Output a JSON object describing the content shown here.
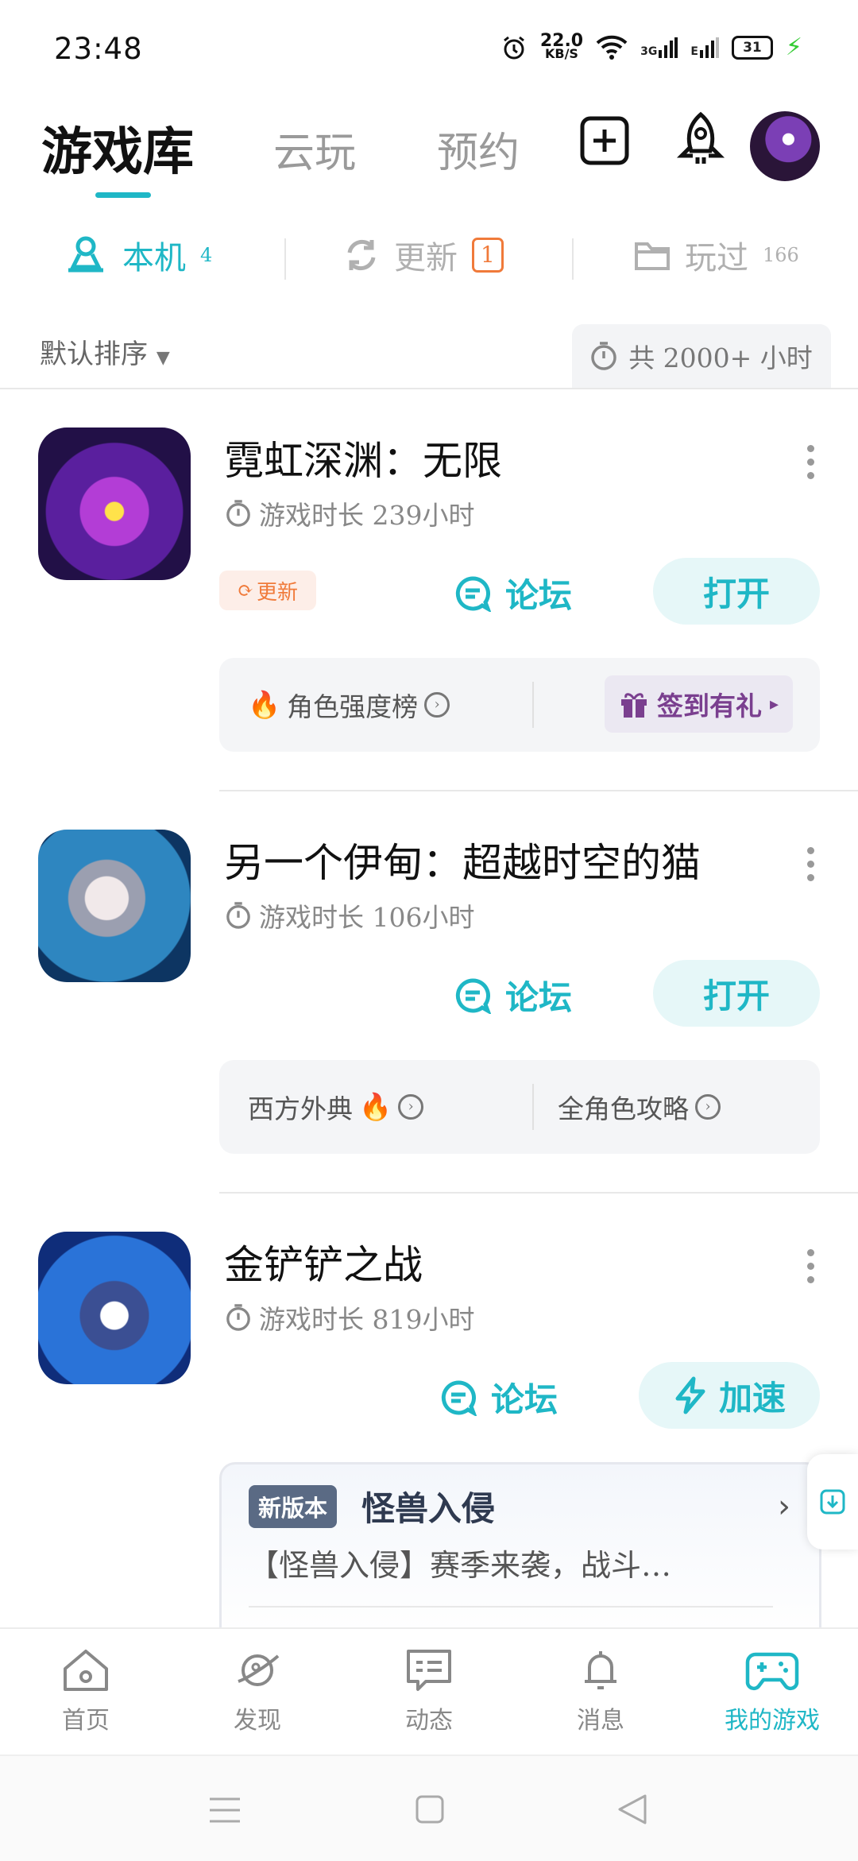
{
  "status_bar": {
    "time": "23:48",
    "net_speed_value": "22.0",
    "net_speed_unit": "KB/S",
    "network_3g": "3G",
    "network_e": "E",
    "battery": "31"
  },
  "header": {
    "tabs": [
      {
        "label": "游戏库",
        "active": true
      },
      {
        "label": "云玩",
        "active": false
      },
      {
        "label": "预约",
        "active": false
      }
    ],
    "icons": [
      "add-square-icon",
      "rocket-icon",
      "avatar"
    ]
  },
  "sub_tabs": [
    {
      "label": "本机",
      "count": "4",
      "icon": "local-device-icon",
      "active": true
    },
    {
      "label": "更新",
      "count": "1",
      "icon": "refresh-icon",
      "active": false
    },
    {
      "label": "玩过",
      "count": "166",
      "icon": "folder-icon",
      "active": false
    }
  ],
  "sort": {
    "label": "默认排序"
  },
  "total_hours": {
    "label": "共 2000+ 小时"
  },
  "games": [
    {
      "title": "霓虹深渊：无限",
      "time_label": "游戏时长 239小时",
      "update_label": "更新",
      "forum_label": "论坛",
      "action_label": "打开",
      "info_left": "角色强度榜",
      "info_right": "签到有礼"
    },
    {
      "title": "另一个伊甸：超越时空的猫",
      "time_label": "游戏时长 106小时",
      "forum_label": "论坛",
      "action_label": "打开",
      "info_left": "西方外典",
      "info_right": "全角色攻略"
    },
    {
      "title": "金铲铲之战",
      "time_label": "游戏时长 819小时",
      "forum_label": "论坛",
      "action_label": "加速",
      "news_tag": "新版本",
      "news_title": "怪兽入侵",
      "news_body": "【怪兽入侵】赛季来袭，战斗…"
    }
  ],
  "bottom_nav": [
    {
      "label": "首页",
      "icon": "home-icon",
      "active": false
    },
    {
      "label": "发现",
      "icon": "planet-icon",
      "active": false
    },
    {
      "label": "动态",
      "icon": "message-icon",
      "active": false
    },
    {
      "label": "消息",
      "icon": "bell-icon",
      "active": false
    },
    {
      "label": "我的游戏",
      "icon": "gamepad-icon",
      "active": true
    }
  ],
  "colors": {
    "accent": "#1fb7c6",
    "update": "#f07a3a",
    "gift": "#7a3f8f"
  }
}
